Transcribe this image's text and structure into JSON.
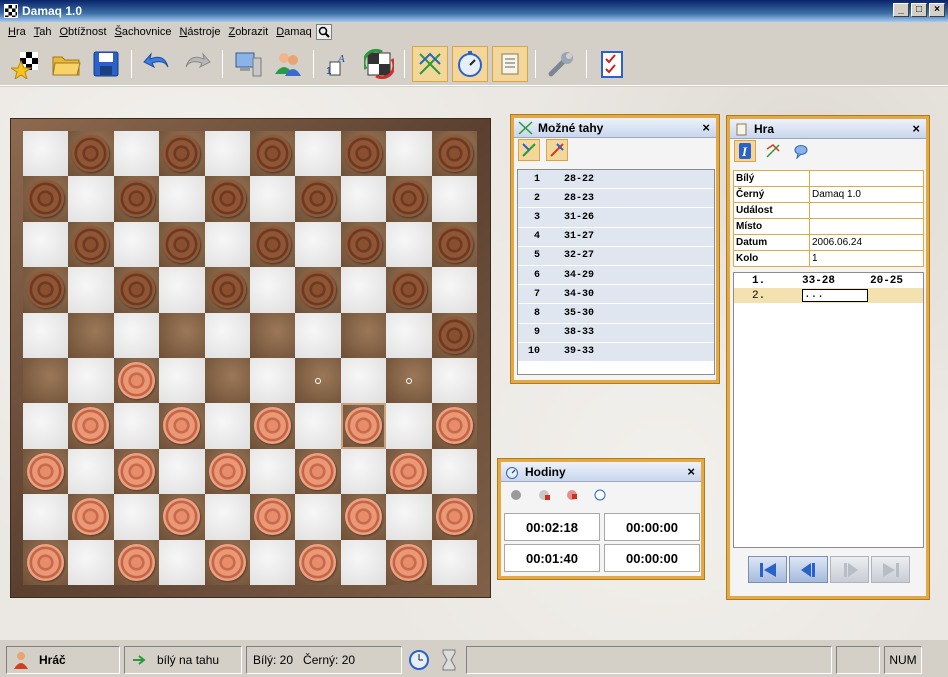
{
  "window": {
    "title": "Damaq 1.0",
    "min": "_",
    "max": "□",
    "close": "×"
  },
  "menu": [
    "Hra",
    "Tah",
    "Obtížnost",
    "Šachovnice",
    "Nástroje",
    "Zobrazit",
    "Damaq"
  ],
  "toolbar": {
    "icons": [
      "new-game-star-icon",
      "open-folder-icon",
      "save-disk-icon",
      "undo-arrow-icon",
      "redo-arrow-icon",
      "computer-icon",
      "players-icon",
      "font-icon",
      "flip-board-icon",
      "possible-moves-icon",
      "clock-icon",
      "notation-scroll-icon",
      "wrench-icon",
      "checklist-icon"
    ],
    "active": [
      "possible-moves-icon",
      "clock-icon",
      "notation-scroll-icon"
    ]
  },
  "board": {
    "rows": [
      "bbbbb",
      "bbbbb",
      "bbbbb",
      "bbbbb",
      "0000b",
      "0w000",
      "wwwww",
      "wwwww",
      "wwwww",
      "wwwww"
    ],
    "selected": {
      "row": 6,
      "col": 7
    },
    "target_dots": [
      {
        "row": 5,
        "col": 6
      },
      {
        "row": 5,
        "col": 8
      }
    ],
    "light": "#e9e9e9",
    "dark": "#866448"
  },
  "moves_panel": {
    "title": "Možné tahy",
    "close": "×",
    "moves": [
      {
        "n": "1",
        "m": "28-22"
      },
      {
        "n": "2",
        "m": "28-23"
      },
      {
        "n": "3",
        "m": "31-26"
      },
      {
        "n": "4",
        "m": "31-27"
      },
      {
        "n": "5",
        "m": "32-27"
      },
      {
        "n": "6",
        "m": "34-29"
      },
      {
        "n": "7",
        "m": "34-30"
      },
      {
        "n": "8",
        "m": "35-30"
      },
      {
        "n": "9",
        "m": "38-33"
      },
      {
        "n": "10",
        "m": "39-33"
      }
    ]
  },
  "clock_panel": {
    "title": "Hodiny",
    "close": "×",
    "times": [
      "00:02:18",
      "00:00:00",
      "00:01:40",
      "00:00:00"
    ]
  },
  "game_panel": {
    "title": "Hra",
    "close": "×",
    "fields": [
      {
        "k": "Bílý",
        "v": ""
      },
      {
        "k": "Černý",
        "v": "Damaq 1.0"
      },
      {
        "k": "Událost",
        "v": ""
      },
      {
        "k": "Místo",
        "v": ""
      },
      {
        "k": "Datum",
        "v": "2006.06.24"
      },
      {
        "k": "Kolo",
        "v": "1"
      }
    ],
    "notation": [
      {
        "num": "1.",
        "white": "33-28",
        "black": "20-25"
      },
      {
        "num": "2.",
        "white": "...",
        "black": ""
      }
    ]
  },
  "status": {
    "player": "Hráč",
    "turn": "bílý na tahu",
    "white_count": "Bílý: 20",
    "black_count": "Černý: 20",
    "num": "NUM"
  },
  "colors": {
    "panel_border": "#e4a942",
    "title_gradient": "#0a246a"
  }
}
